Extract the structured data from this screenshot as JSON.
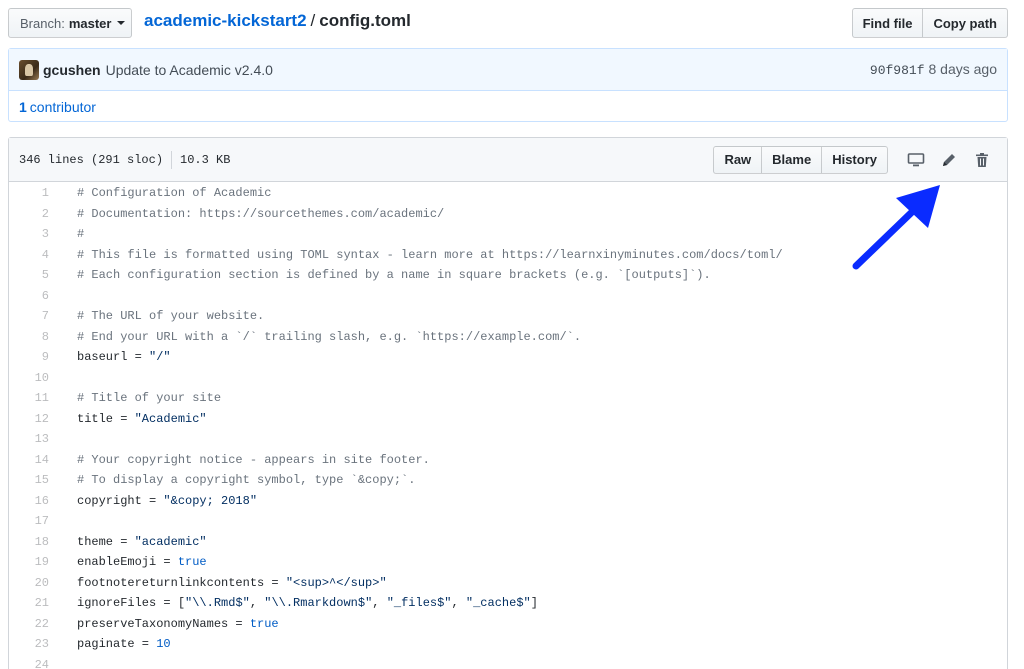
{
  "topbar": {
    "branch_label": "Branch:",
    "branch_value": "master",
    "repo": "academic-kickstart2",
    "separator": "/",
    "file": "config.toml",
    "find_file": "Find file",
    "copy_path": "Copy path"
  },
  "commit": {
    "author": "gcushen",
    "message": "Update to Academic v2.4.0",
    "sha": "90f981f",
    "time": "8 days ago",
    "contributors_count": "1",
    "contributors_label": "contributor"
  },
  "file": {
    "lines_info": "346 lines (291 sloc)",
    "size": "10.3 KB",
    "raw": "Raw",
    "blame": "Blame",
    "history": "History"
  },
  "icons": {
    "desktop": "desktop-icon",
    "edit": "pencil-icon",
    "delete": "trash-icon",
    "annotation": "blue-arrow"
  },
  "colors": {
    "link": "#0366d6",
    "arrow": "#0a2bff",
    "comment": "#6a737d",
    "string": "#032f62",
    "keyword": "#005cc5"
  },
  "code_lines": [
    {
      "n": "1",
      "parts": [
        {
          "t": "# Configuration of Academic",
          "k": "c"
        }
      ]
    },
    {
      "n": "2",
      "parts": [
        {
          "t": "# Documentation: https://sourcethemes.com/academic/",
          "k": "c"
        }
      ]
    },
    {
      "n": "3",
      "parts": [
        {
          "t": "#",
          "k": "c"
        }
      ]
    },
    {
      "n": "4",
      "parts": [
        {
          "t": "# This file is formatted using TOML syntax - learn more at https://learnxinyminutes.com/docs/toml/",
          "k": "c"
        }
      ]
    },
    {
      "n": "5",
      "parts": [
        {
          "t": "# Each configuration section is defined by a name in square brackets (e.g. `[outputs]`).",
          "k": "c"
        }
      ]
    },
    {
      "n": "6",
      "parts": []
    },
    {
      "n": "7",
      "parts": [
        {
          "t": "# The URL of your website.",
          "k": "c"
        }
      ]
    },
    {
      "n": "8",
      "parts": [
        {
          "t": "# End your URL with a `/` trailing slash, e.g. `https://example.com/`.",
          "k": "c"
        }
      ]
    },
    {
      "n": "9",
      "parts": [
        {
          "t": "baseurl = ",
          "k": ""
        },
        {
          "t": "\"/\"",
          "k": "s"
        }
      ]
    },
    {
      "n": "10",
      "parts": []
    },
    {
      "n": "11",
      "parts": [
        {
          "t": "# Title of your site",
          "k": "c"
        }
      ]
    },
    {
      "n": "12",
      "parts": [
        {
          "t": "title = ",
          "k": ""
        },
        {
          "t": "\"Academic\"",
          "k": "s"
        }
      ]
    },
    {
      "n": "13",
      "parts": []
    },
    {
      "n": "14",
      "parts": [
        {
          "t": "# Your copyright notice - appears in site footer.",
          "k": "c"
        }
      ]
    },
    {
      "n": "15",
      "parts": [
        {
          "t": "# To display a copyright symbol, type `&copy;`.",
          "k": "c"
        }
      ]
    },
    {
      "n": "16",
      "parts": [
        {
          "t": "copyright = ",
          "k": ""
        },
        {
          "t": "\"&copy; 2018\"",
          "k": "s"
        }
      ]
    },
    {
      "n": "17",
      "parts": []
    },
    {
      "n": "18",
      "parts": [
        {
          "t": "theme = ",
          "k": ""
        },
        {
          "t": "\"academic\"",
          "k": "s"
        }
      ]
    },
    {
      "n": "19",
      "parts": [
        {
          "t": "enableEmoji = ",
          "k": ""
        },
        {
          "t": "true",
          "k": "k"
        }
      ]
    },
    {
      "n": "20",
      "parts": [
        {
          "t": "footnotereturnlinkcontents = ",
          "k": ""
        },
        {
          "t": "\"<sup>^</sup>\"",
          "k": "s"
        }
      ]
    },
    {
      "n": "21",
      "parts": [
        {
          "t": "ignoreFiles = [",
          "k": ""
        },
        {
          "t": "\"\\\\.Rmd$\"",
          "k": "s"
        },
        {
          "t": ", ",
          "k": ""
        },
        {
          "t": "\"\\\\.Rmarkdown$\"",
          "k": "s"
        },
        {
          "t": ", ",
          "k": ""
        },
        {
          "t": "\"_files$\"",
          "k": "s"
        },
        {
          "t": ", ",
          "k": ""
        },
        {
          "t": "\"_cache$\"",
          "k": "s"
        },
        {
          "t": "]",
          "k": ""
        }
      ]
    },
    {
      "n": "22",
      "parts": [
        {
          "t": "preserveTaxonomyNames = ",
          "k": ""
        },
        {
          "t": "true",
          "k": "k"
        }
      ]
    },
    {
      "n": "23",
      "parts": [
        {
          "t": "paginate = ",
          "k": ""
        },
        {
          "t": "10",
          "k": "k"
        }
      ]
    },
    {
      "n": "24",
      "parts": []
    }
  ]
}
